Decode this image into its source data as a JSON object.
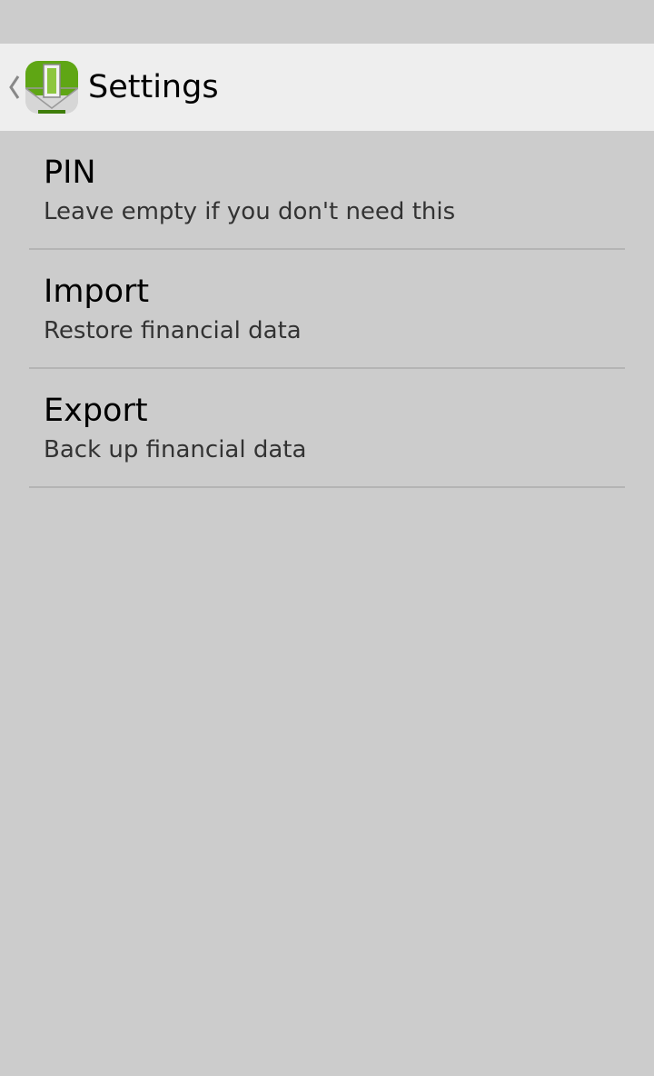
{
  "action_bar": {
    "title": "Settings",
    "up_icon": "chevron-left-icon",
    "app_icon": "wallet-app-icon"
  },
  "preferences": [
    {
      "title": "PIN",
      "summary": "Leave empty if you don't need this"
    },
    {
      "title": "Import",
      "summary": "Restore financial data"
    },
    {
      "title": "Export",
      "summary": "Back up financial data"
    }
  ],
  "colors": {
    "background": "#cccccc",
    "action_bar": "#eeeeee",
    "divider": "#b4b4b4",
    "icon_green": "#5fa614"
  }
}
